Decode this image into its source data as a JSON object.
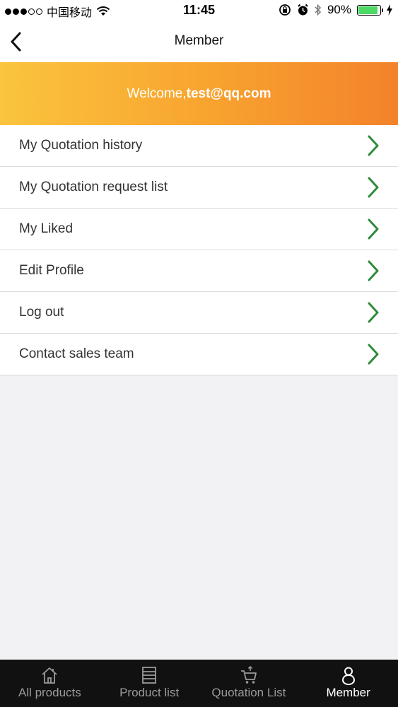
{
  "status_bar": {
    "carrier": "中国移动",
    "time": "11:45",
    "battery_percent": "90%",
    "battery_level": 0.9,
    "signal_bars": 3,
    "icons": [
      "wifi-icon",
      "orientation-lock-icon",
      "alarm-icon",
      "bluetooth-icon",
      "battery-icon",
      "charging-icon"
    ]
  },
  "nav": {
    "title": "Member",
    "back_icon": "chevron-left-icon"
  },
  "welcome": {
    "prefix": "Welcome,",
    "email": "test@qq.com"
  },
  "menu": {
    "items": [
      {
        "label": "My Quotation history"
      },
      {
        "label": "My Quotation request list"
      },
      {
        "label": "My Liked"
      },
      {
        "label": "Edit Profile"
      },
      {
        "label": "Log out"
      },
      {
        "label": "Contact sales team"
      }
    ],
    "chevron_color": "#2e8b3a"
  },
  "tabs": [
    {
      "label": "All products",
      "icon": "home-icon",
      "active": false
    },
    {
      "label": "Product list",
      "icon": "list-icon",
      "active": false
    },
    {
      "label": "Quotation List",
      "icon": "cart-icon",
      "active": false
    },
    {
      "label": "Member",
      "icon": "person-icon",
      "active": true
    }
  ],
  "colors": {
    "banner_start": "#fbc43d",
    "banner_end": "#f3822a",
    "tab_bar_bg": "#111111",
    "accent_green": "#2e8b3a"
  }
}
